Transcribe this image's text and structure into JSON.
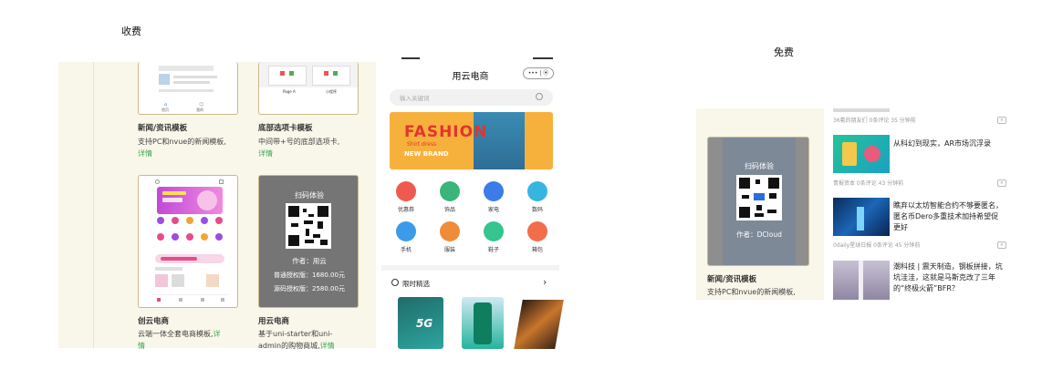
{
  "labels": {
    "paid": "收费",
    "free": "免费"
  },
  "paid_panel": {
    "top_left": {
      "name": "新闻/资讯模板",
      "desc": "支持PC和nvue的新闻模板,",
      "link": "详情"
    },
    "top_right": {
      "name": "底部选项卡模板",
      "desc": "中间带+号的底部选项卡,",
      "link": "详情"
    },
    "bottom_left": {
      "name": "创云电商",
      "desc1": "云端一体全套电商模板,",
      "link": "详",
      "link2": "情"
    },
    "bottom_right": {
      "name": "用云电商",
      "desc1": "基于uni-starter和uni-",
      "desc2": "admin的购物商城,",
      "link": "详情",
      "qr": {
        "title": "扫码体验",
        "author": "作者：用云",
        "price1": "普通授权版：1680.00元",
        "price2": "源码授权版：2580.00元"
      }
    },
    "top_left_tab_labels": [
      "首页",
      "我的"
    ],
    "top_right_tab_labels": [
      "Page A",
      "小程序"
    ]
  },
  "phone": {
    "title": "用云电商",
    "capsule": "••• | ⦿",
    "search_placeholder": "输入关键词",
    "banner": {
      "headline": "FASHION",
      "sub": "Shirt dress",
      "brand": "NEW BRAND"
    },
    "categories": [
      {
        "label": "优惠券",
        "color": "#ef5a4f"
      },
      {
        "label": "饰品",
        "color": "#3bb57a"
      },
      {
        "label": "家电",
        "color": "#3c7be8"
      },
      {
        "label": "数码",
        "color": "#35b5e0"
      },
      {
        "label": "手机",
        "color": "#3c9be8"
      },
      {
        "label": "服装",
        "color": "#f08b3a"
      },
      {
        "label": "鞋子",
        "color": "#35c58e"
      },
      {
        "label": "箱包",
        "color": "#f06e4a"
      }
    ],
    "section": {
      "title": "限时精选",
      "arrow": "›"
    },
    "product_badge": "5G"
  },
  "free_panel": {
    "thumb": {
      "name": "新闻/资讯模板",
      "desc": "支持PC和nvue的新闻模板,",
      "qr_title": "扫码体验",
      "author": "作者：DCloud"
    },
    "news": [
      {
        "meta": "36氪的朋友们  0条评论  35 分钟前",
        "title": "",
        "close": "×"
      },
      {
        "meta": "青报资本  0条评论  43 分钟前",
        "title": "从科幻到现实，AR市场沉浮录",
        "close": "×"
      },
      {
        "meta": "0daily星球日报  0条评论  45 分钟前",
        "title": "瞧弃以太坊智能合约不够要匿名，匿名币Dero多重技术加持希望促更好",
        "close": "×"
      },
      {
        "meta": "",
        "title": "潮科技 | 震天制造，钢板拼接，坑坑洼洼，这就是马斯克改了三年的“终极火箭”BFR？",
        "close": "×"
      }
    ]
  }
}
